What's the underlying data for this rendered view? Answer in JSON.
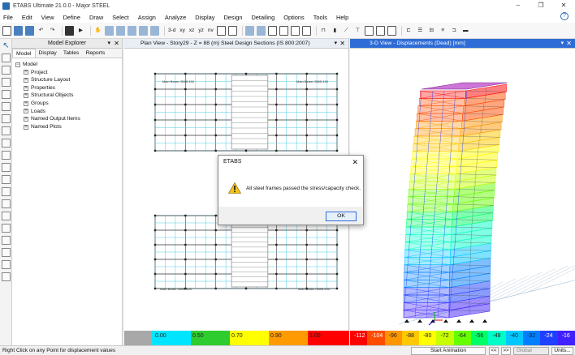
{
  "window": {
    "title": "ETABS Ultimate 21.0.0 - Major STEEL",
    "controls": [
      "–",
      "❐",
      "✕"
    ]
  },
  "menu": [
    "File",
    "Edit",
    "View",
    "Define",
    "Draw",
    "Select",
    "Assign",
    "Analyze",
    "Display",
    "Design",
    "Detailing",
    "Options",
    "Tools",
    "Help"
  ],
  "toolbar": {
    "label_3d": "3-d",
    "label_xy": "xy",
    "label_xz": "xz",
    "label_yz": "yz",
    "label_nv": "nv"
  },
  "explorer": {
    "title": "Model Explorer",
    "tabs": [
      "Model",
      "Display",
      "Tables",
      "Reports"
    ],
    "root": "Model",
    "items": [
      "Project",
      "Structure Layout",
      "Properties",
      "Structural Objects",
      "Groups",
      "Loads",
      "Named Output Items",
      "Named Plots"
    ]
  },
  "plan_view": {
    "title": "Plan View - Story29 - Z = 88 (m)  Steel Design Sections  (IS 800:2007)",
    "beam_label": "Main Beam",
    "beam_code": "ISMB 450"
  },
  "view_3d": {
    "title": "3-D View  - Displacements (Dead)  [mm]"
  },
  "ratio_scale": {
    "labels": [
      "0.00",
      "0.50",
      "0.70",
      "0.90",
      "1.00"
    ],
    "colors": [
      "#a8a8a8",
      "#00e5ff",
      "#2ecc2e",
      "#ffff00",
      "#ff9a00",
      "#ff0000"
    ]
  },
  "displacement_scale": {
    "labels": [
      "-112",
      "-104",
      "-96",
      "-88",
      "-80",
      "-72",
      "-64",
      "-56",
      "-48",
      "-40",
      "-32",
      "-24",
      "-16"
    ],
    "colors": [
      "#ff0000",
      "#ff4d00",
      "#ff9500",
      "#ffc800",
      "#ffff00",
      "#c8ff00",
      "#66ff00",
      "#00ff66",
      "#00ffc8",
      "#00c8ff",
      "#0080ff",
      "#2040ff",
      "#4020ff"
    ]
  },
  "dialog": {
    "title": "ETABS",
    "message": "All steel frames passed the stress/capacity check.",
    "ok_label": "OK"
  },
  "status": {
    "message": "Right Click on any Point for displacement values",
    "animation_label": "Start Animation",
    "prev": "<<",
    "next": ">>",
    "coord_system": "Global",
    "units_label": "Units..."
  }
}
